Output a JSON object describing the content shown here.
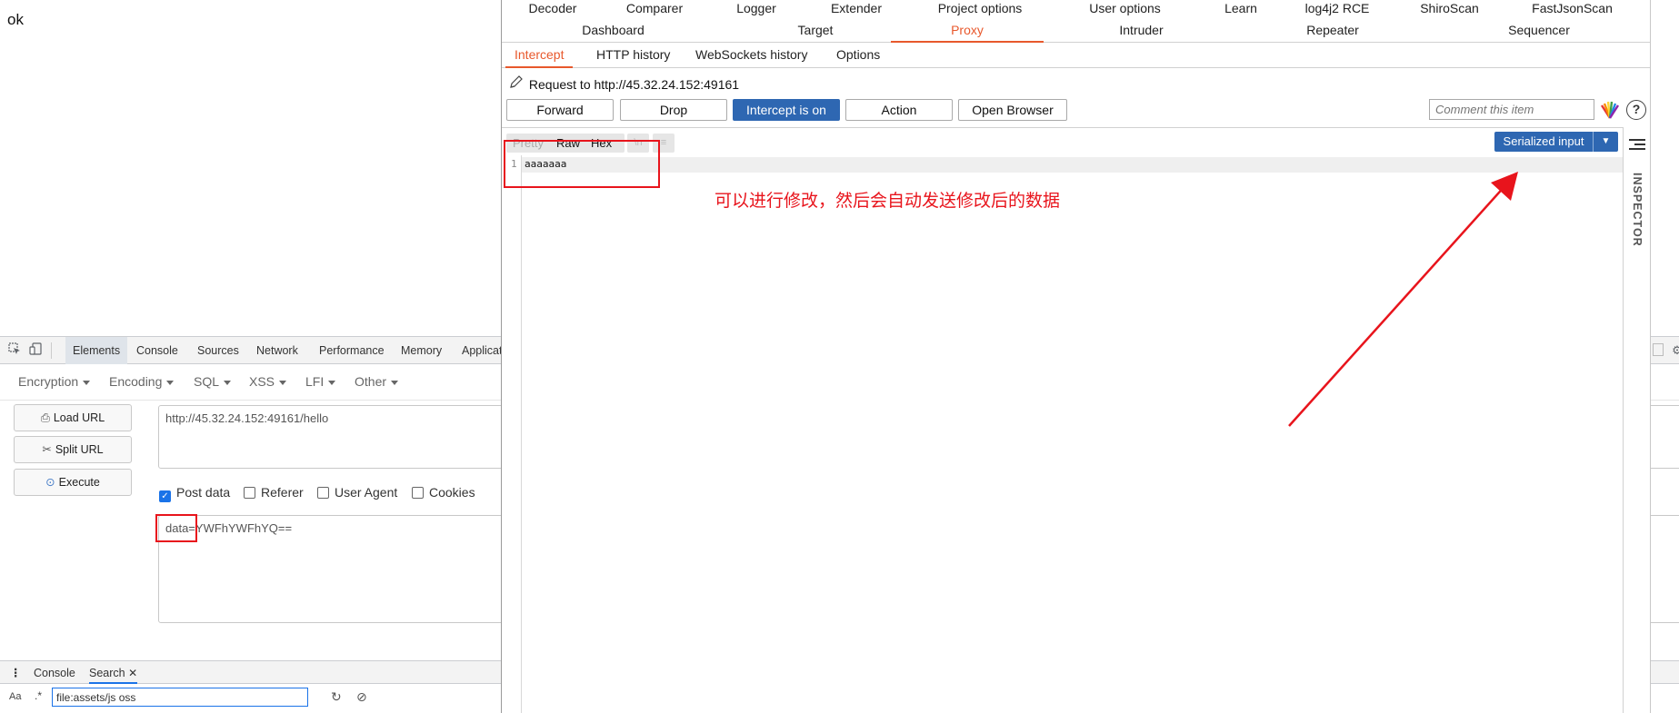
{
  "page": {
    "body_text": "ok"
  },
  "devtools": {
    "tabs": [
      "Elements",
      "Console",
      "Sources",
      "Network",
      "Performance",
      "Memory",
      "Applicat"
    ],
    "active_tab": "Elements",
    "hackbar": {
      "menus": [
        "Encryption",
        "Encoding",
        "SQL",
        "XSS",
        "LFI",
        "Other"
      ],
      "buttons": {
        "load_url": "Load URL",
        "split_url": "Split URL",
        "execute": "Execute"
      },
      "url_value": "http://45.32.24.152:49161/hello",
      "checkboxes": [
        {
          "label": "Post data",
          "checked": true
        },
        {
          "label": "Referer",
          "checked": false
        },
        {
          "label": "User Agent",
          "checked": false
        },
        {
          "label": "Cookies",
          "checked": false
        }
      ],
      "post_value": "data=YWFhYWFhYQ=="
    },
    "drawer": {
      "tabs": [
        "Console",
        "Search"
      ],
      "active_tab": "Search",
      "search_case_label": "Aa",
      "search_regex_label": ".*",
      "search_value": "file:assets/js oss"
    }
  },
  "burp": {
    "top_tabs_row1": [
      "Decoder",
      "Comparer",
      "Logger",
      "Extender",
      "Project options",
      "User options",
      "Learn",
      "log4j2 RCE",
      "ShiroScan",
      "FastJsonScan"
    ],
    "top_tabs_row2": [
      "Dashboard",
      "Target",
      "Proxy",
      "Intruder",
      "Repeater",
      "Sequencer"
    ],
    "active_top_tab": "Proxy",
    "proxy_tabs": [
      "Intercept",
      "HTTP history",
      "WebSockets history",
      "Options"
    ],
    "active_proxy_tab": "Intercept",
    "request_line": "Request to http://45.32.24.152:49161",
    "buttons": {
      "forward": "Forward",
      "drop": "Drop",
      "intercept": "Intercept is on",
      "action": "Action",
      "open_browser": "Open Browser"
    },
    "comment_placeholder": "Comment this item",
    "help_label": "?",
    "editor": {
      "view_tabs": [
        "Pretty",
        "Raw",
        "Hex"
      ],
      "newline_label": "\\n",
      "line_number": "1",
      "line_text": "aaaaaaa",
      "serialized_label": "Serialized input"
    },
    "inspector_label": "INSPECTOR"
  },
  "annotation": {
    "text": "可以进行修改，然后会自动发送修改后的数据",
    "color": "#e8141c"
  },
  "colors": {
    "burp_accent": "#e8582c",
    "burp_button_blue": "#2e67b2"
  }
}
